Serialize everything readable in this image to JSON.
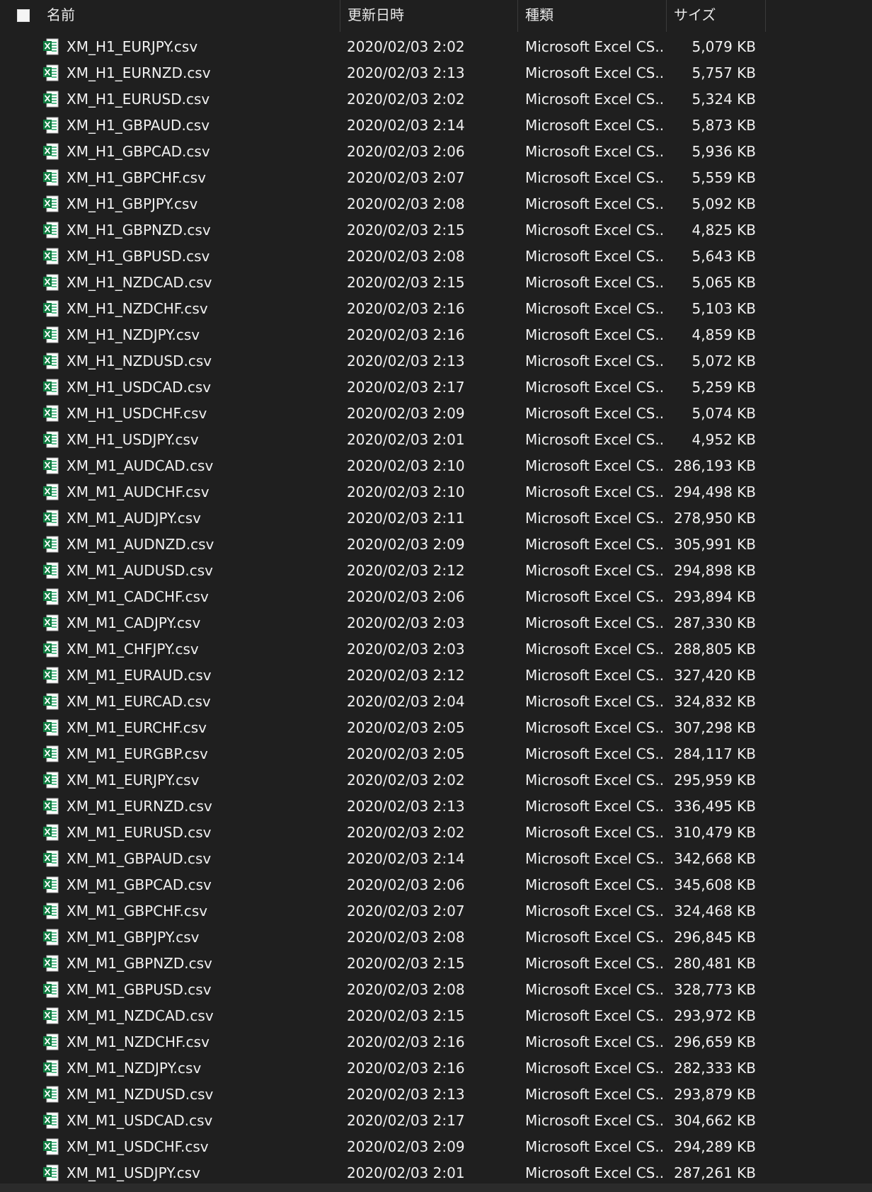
{
  "columns": {
    "name": "名前",
    "date": "更新日時",
    "type": "種類",
    "size": "サイズ"
  },
  "icon_name": "excel-csv-icon",
  "files": [
    {
      "name": "XM_H1_EURJPY.csv",
      "date": "2020/02/03 2:02",
      "type": "Microsoft Excel CS...",
      "size": "5,079 KB"
    },
    {
      "name": "XM_H1_EURNZD.csv",
      "date": "2020/02/03 2:13",
      "type": "Microsoft Excel CS...",
      "size": "5,757 KB"
    },
    {
      "name": "XM_H1_EURUSD.csv",
      "date": "2020/02/03 2:02",
      "type": "Microsoft Excel CS...",
      "size": "5,324 KB"
    },
    {
      "name": "XM_H1_GBPAUD.csv",
      "date": "2020/02/03 2:14",
      "type": "Microsoft Excel CS...",
      "size": "5,873 KB"
    },
    {
      "name": "XM_H1_GBPCAD.csv",
      "date": "2020/02/03 2:06",
      "type": "Microsoft Excel CS...",
      "size": "5,936 KB"
    },
    {
      "name": "XM_H1_GBPCHF.csv",
      "date": "2020/02/03 2:07",
      "type": "Microsoft Excel CS...",
      "size": "5,559 KB"
    },
    {
      "name": "XM_H1_GBPJPY.csv",
      "date": "2020/02/03 2:08",
      "type": "Microsoft Excel CS...",
      "size": "5,092 KB"
    },
    {
      "name": "XM_H1_GBPNZD.csv",
      "date": "2020/02/03 2:15",
      "type": "Microsoft Excel CS...",
      "size": "4,825 KB"
    },
    {
      "name": "XM_H1_GBPUSD.csv",
      "date": "2020/02/03 2:08",
      "type": "Microsoft Excel CS...",
      "size": "5,643 KB"
    },
    {
      "name": "XM_H1_NZDCAD.csv",
      "date": "2020/02/03 2:15",
      "type": "Microsoft Excel CS...",
      "size": "5,065 KB"
    },
    {
      "name": "XM_H1_NZDCHF.csv",
      "date": "2020/02/03 2:16",
      "type": "Microsoft Excel CS...",
      "size": "5,103 KB"
    },
    {
      "name": "XM_H1_NZDJPY.csv",
      "date": "2020/02/03 2:16",
      "type": "Microsoft Excel CS...",
      "size": "4,859 KB"
    },
    {
      "name": "XM_H1_NZDUSD.csv",
      "date": "2020/02/03 2:13",
      "type": "Microsoft Excel CS...",
      "size": "5,072 KB"
    },
    {
      "name": "XM_H1_USDCAD.csv",
      "date": "2020/02/03 2:17",
      "type": "Microsoft Excel CS...",
      "size": "5,259 KB"
    },
    {
      "name": "XM_H1_USDCHF.csv",
      "date": "2020/02/03 2:09",
      "type": "Microsoft Excel CS...",
      "size": "5,074 KB"
    },
    {
      "name": "XM_H1_USDJPY.csv",
      "date": "2020/02/03 2:01",
      "type": "Microsoft Excel CS...",
      "size": "4,952 KB"
    },
    {
      "name": "XM_M1_AUDCAD.csv",
      "date": "2020/02/03 2:10",
      "type": "Microsoft Excel CS...",
      "size": "286,193 KB"
    },
    {
      "name": "XM_M1_AUDCHF.csv",
      "date": "2020/02/03 2:10",
      "type": "Microsoft Excel CS...",
      "size": "294,498 KB"
    },
    {
      "name": "XM_M1_AUDJPY.csv",
      "date": "2020/02/03 2:11",
      "type": "Microsoft Excel CS...",
      "size": "278,950 KB"
    },
    {
      "name": "XM_M1_AUDNZD.csv",
      "date": "2020/02/03 2:09",
      "type": "Microsoft Excel CS...",
      "size": "305,991 KB"
    },
    {
      "name": "XM_M1_AUDUSD.csv",
      "date": "2020/02/03 2:12",
      "type": "Microsoft Excel CS...",
      "size": "294,898 KB"
    },
    {
      "name": "XM_M1_CADCHF.csv",
      "date": "2020/02/03 2:06",
      "type": "Microsoft Excel CS...",
      "size": "293,894 KB"
    },
    {
      "name": "XM_M1_CADJPY.csv",
      "date": "2020/02/03 2:03",
      "type": "Microsoft Excel CS...",
      "size": "287,330 KB"
    },
    {
      "name": "XM_M1_CHFJPY.csv",
      "date": "2020/02/03 2:03",
      "type": "Microsoft Excel CS...",
      "size": "288,805 KB"
    },
    {
      "name": "XM_M1_EURAUD.csv",
      "date": "2020/02/03 2:12",
      "type": "Microsoft Excel CS...",
      "size": "327,420 KB"
    },
    {
      "name": "XM_M1_EURCAD.csv",
      "date": "2020/02/03 2:04",
      "type": "Microsoft Excel CS...",
      "size": "324,832 KB"
    },
    {
      "name": "XM_M1_EURCHF.csv",
      "date": "2020/02/03 2:05",
      "type": "Microsoft Excel CS...",
      "size": "307,298 KB"
    },
    {
      "name": "XM_M1_EURGBP.csv",
      "date": "2020/02/03 2:05",
      "type": "Microsoft Excel CS...",
      "size": "284,117 KB"
    },
    {
      "name": "XM_M1_EURJPY.csv",
      "date": "2020/02/03 2:02",
      "type": "Microsoft Excel CS...",
      "size": "295,959 KB"
    },
    {
      "name": "XM_M1_EURNZD.csv",
      "date": "2020/02/03 2:13",
      "type": "Microsoft Excel CS...",
      "size": "336,495 KB"
    },
    {
      "name": "XM_M1_EURUSD.csv",
      "date": "2020/02/03 2:02",
      "type": "Microsoft Excel CS...",
      "size": "310,479 KB"
    },
    {
      "name": "XM_M1_GBPAUD.csv",
      "date": "2020/02/03 2:14",
      "type": "Microsoft Excel CS...",
      "size": "342,668 KB"
    },
    {
      "name": "XM_M1_GBPCAD.csv",
      "date": "2020/02/03 2:06",
      "type": "Microsoft Excel CS...",
      "size": "345,608 KB"
    },
    {
      "name": "XM_M1_GBPCHF.csv",
      "date": "2020/02/03 2:07",
      "type": "Microsoft Excel CS...",
      "size": "324,468 KB"
    },
    {
      "name": "XM_M1_GBPJPY.csv",
      "date": "2020/02/03 2:08",
      "type": "Microsoft Excel CS...",
      "size": "296,845 KB"
    },
    {
      "name": "XM_M1_GBPNZD.csv",
      "date": "2020/02/03 2:15",
      "type": "Microsoft Excel CS...",
      "size": "280,481 KB"
    },
    {
      "name": "XM_M1_GBPUSD.csv",
      "date": "2020/02/03 2:08",
      "type": "Microsoft Excel CS...",
      "size": "328,773 KB"
    },
    {
      "name": "XM_M1_NZDCAD.csv",
      "date": "2020/02/03 2:15",
      "type": "Microsoft Excel CS...",
      "size": "293,972 KB"
    },
    {
      "name": "XM_M1_NZDCHF.csv",
      "date": "2020/02/03 2:16",
      "type": "Microsoft Excel CS...",
      "size": "296,659 KB"
    },
    {
      "name": "XM_M1_NZDJPY.csv",
      "date": "2020/02/03 2:16",
      "type": "Microsoft Excel CS...",
      "size": "282,333 KB"
    },
    {
      "name": "XM_M1_NZDUSD.csv",
      "date": "2020/02/03 2:13",
      "type": "Microsoft Excel CS...",
      "size": "293,879 KB"
    },
    {
      "name": "XM_M1_USDCAD.csv",
      "date": "2020/02/03 2:17",
      "type": "Microsoft Excel CS...",
      "size": "304,662 KB"
    },
    {
      "name": "XM_M1_USDCHF.csv",
      "date": "2020/02/03 2:09",
      "type": "Microsoft Excel CS...",
      "size": "294,289 KB"
    },
    {
      "name": "XM_M1_USDJPY.csv",
      "date": "2020/02/03 2:01",
      "type": "Microsoft Excel CS...",
      "size": "287,261 KB"
    }
  ]
}
